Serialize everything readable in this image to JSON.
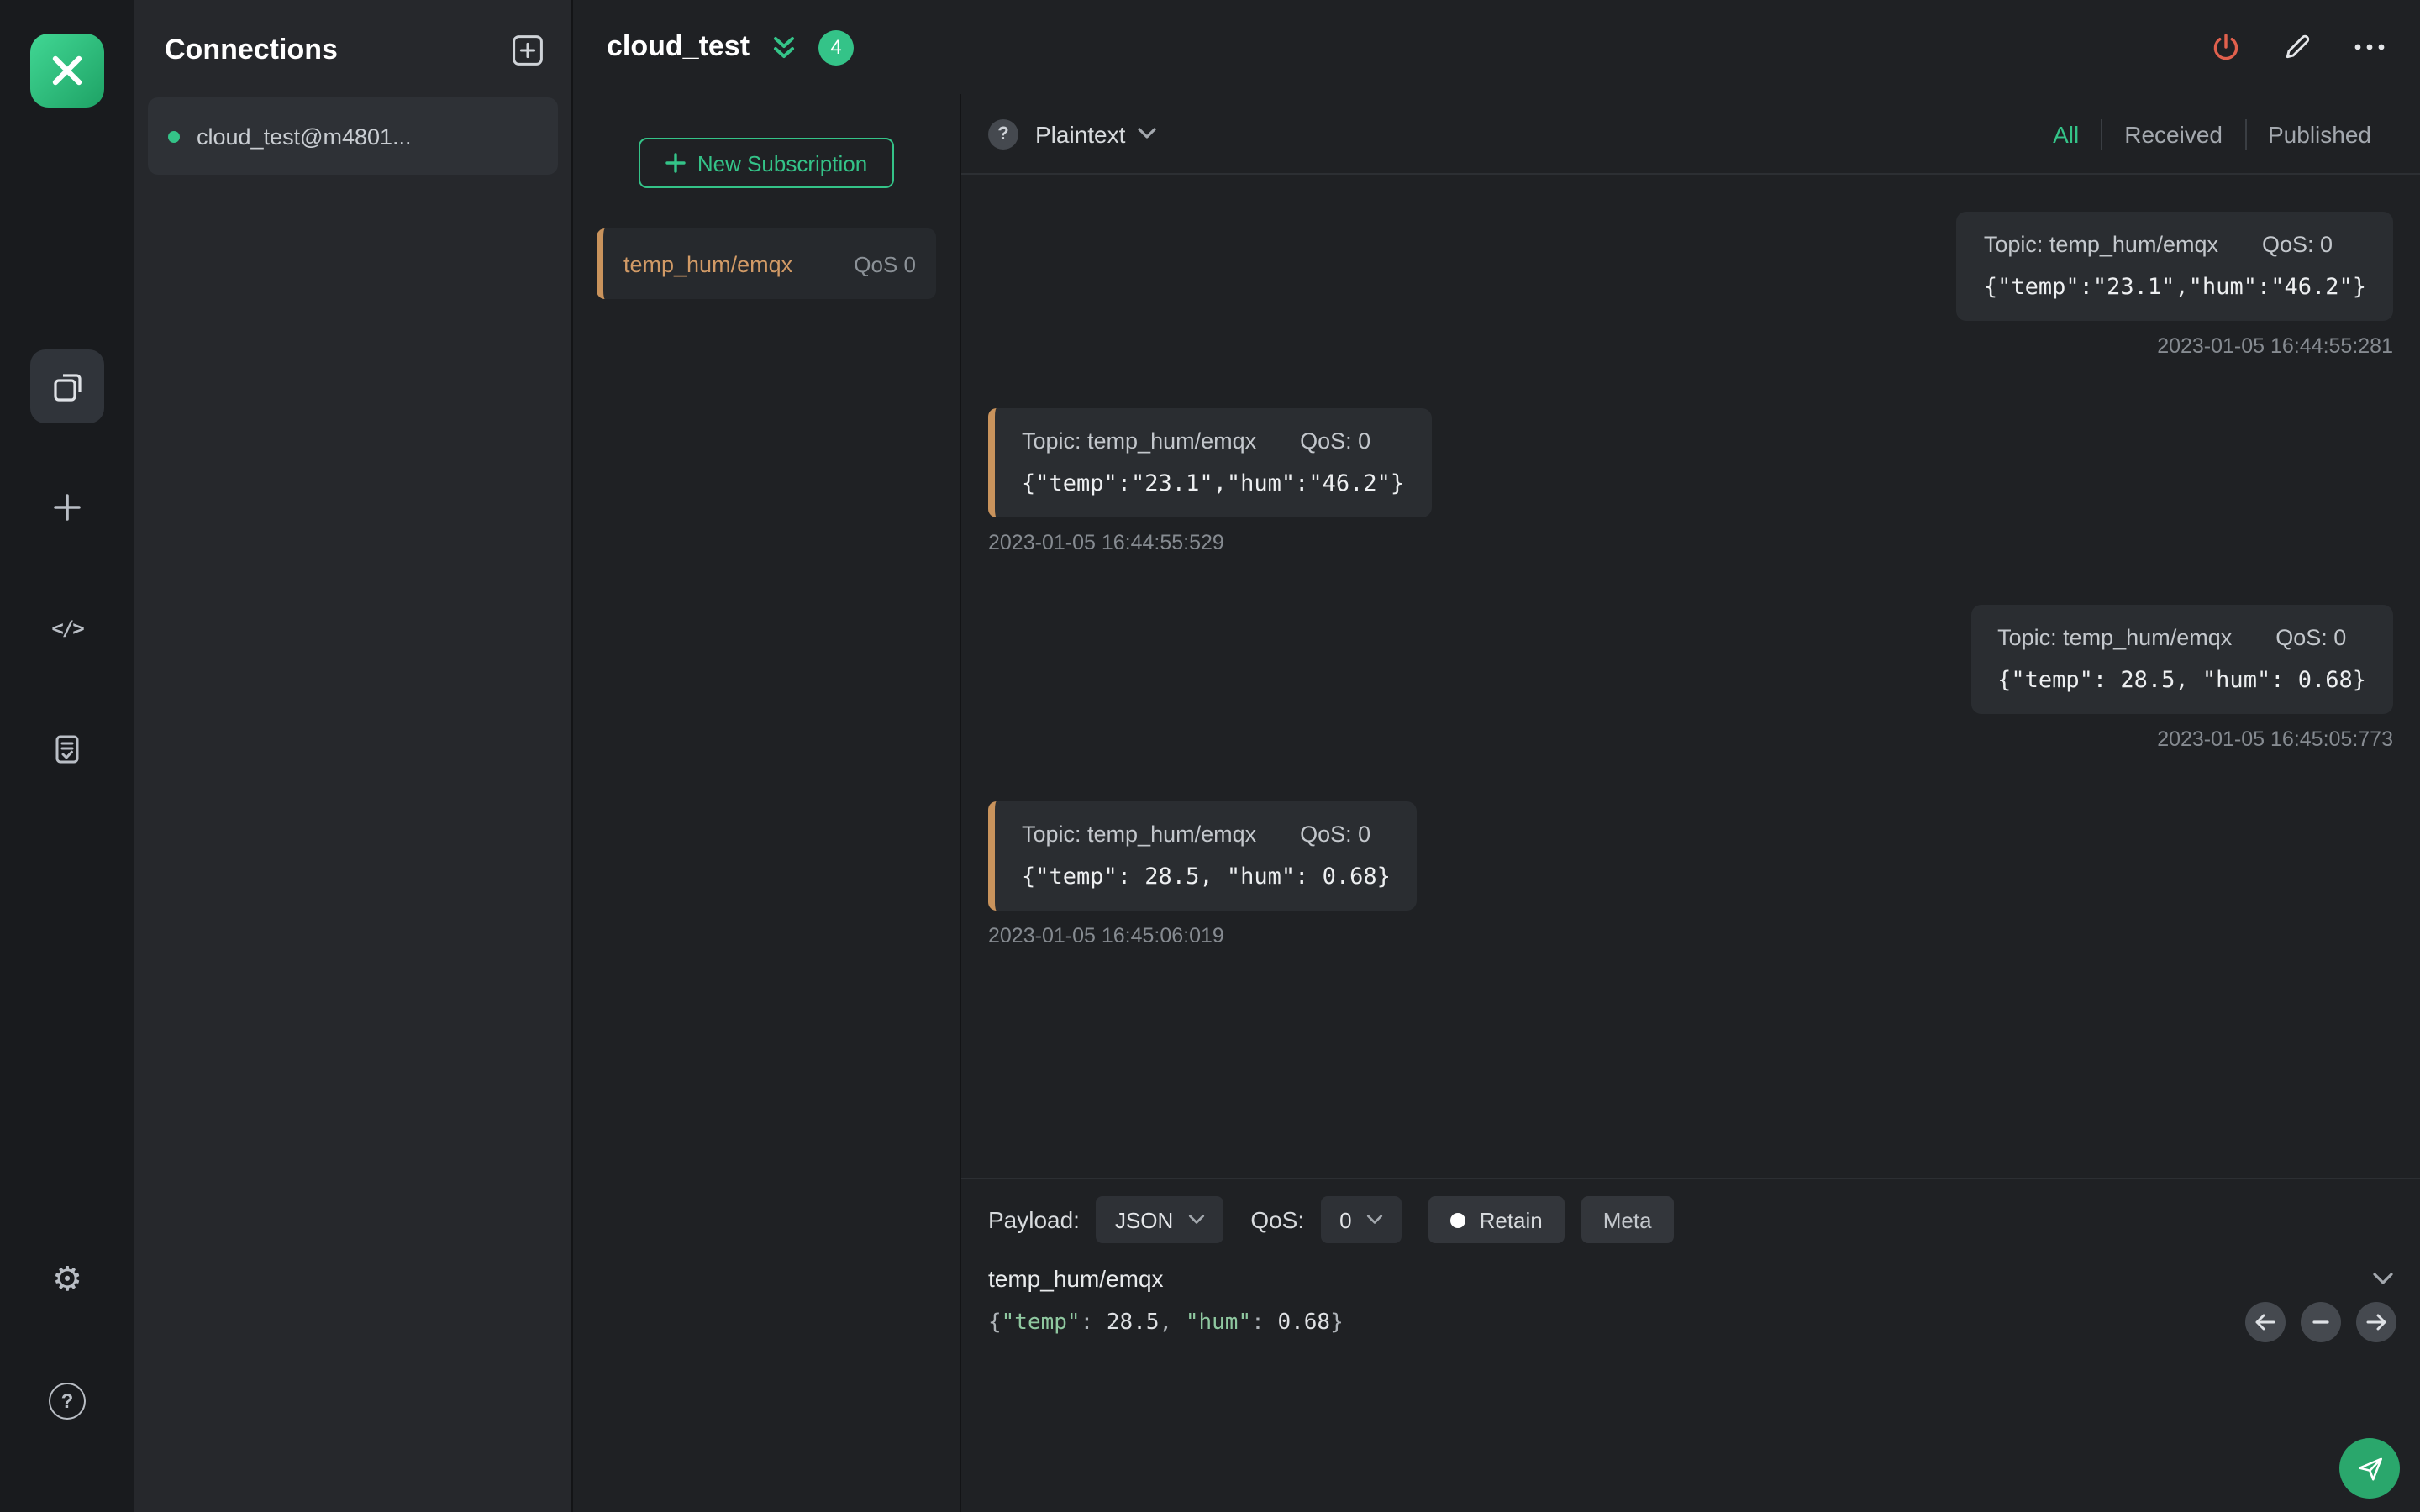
{
  "colors": {
    "accent_green": "#34c388",
    "subscription_orange": "#c9935c",
    "disconnect_red": "#e0604d",
    "panel_dark": "#1f2124"
  },
  "icons": {
    "settings_glyph": "⚙",
    "help_glyph": "?",
    "code_glyph": "</>",
    "msg_help_glyph": "?"
  },
  "connections_panel": {
    "title": "Connections",
    "items": [
      {
        "name": "cloud_test@m4801...",
        "status": "connected"
      }
    ]
  },
  "titlebar": {
    "title": "cloud_test",
    "badge_count": "4"
  },
  "subscriptions": {
    "new_button_label": "New Subscription",
    "items": [
      {
        "topic": "temp_hum/emqx",
        "qos": "QoS 0"
      }
    ]
  },
  "message_bar": {
    "format": "Plaintext",
    "filters": [
      {
        "label": "All",
        "active": true
      },
      {
        "label": "Received",
        "active": false
      },
      {
        "label": "Published",
        "active": false
      }
    ]
  },
  "messages": {
    "items": [
      {
        "align": "right",
        "topic": "Topic: temp_hum/emqx",
        "qos": "QoS: 0",
        "payload": "{\"temp\":\"23.1\",\"hum\":\"46.2\"}",
        "time": "2023-01-05 16:44:55:281"
      },
      {
        "align": "left",
        "topic": "Topic: temp_hum/emqx",
        "qos": "QoS: 0",
        "payload": "{\"temp\":\"23.1\",\"hum\":\"46.2\"}",
        "time": "2023-01-05 16:44:55:529"
      },
      {
        "align": "right",
        "topic": "Topic: temp_hum/emqx",
        "qos": "QoS: 0",
        "payload": "{\"temp\": 28.5, \"hum\": 0.68}",
        "time": "2023-01-05 16:45:05:773"
      },
      {
        "align": "left",
        "topic": "Topic: temp_hum/emqx",
        "qos": "QoS: 0",
        "payload": "{\"temp\": 28.5, \"hum\": 0.68}",
        "time": "2023-01-05 16:45:06:019"
      }
    ]
  },
  "publish": {
    "payload_label": "Payload:",
    "payload_format": "JSON",
    "qos_label": "QoS:",
    "qos_value": "0",
    "retain_label": "Retain",
    "meta_label": "Meta",
    "topic": "temp_hum/emqx",
    "payload": "{\"temp\": 28.5, \"hum\": 0.68}"
  }
}
